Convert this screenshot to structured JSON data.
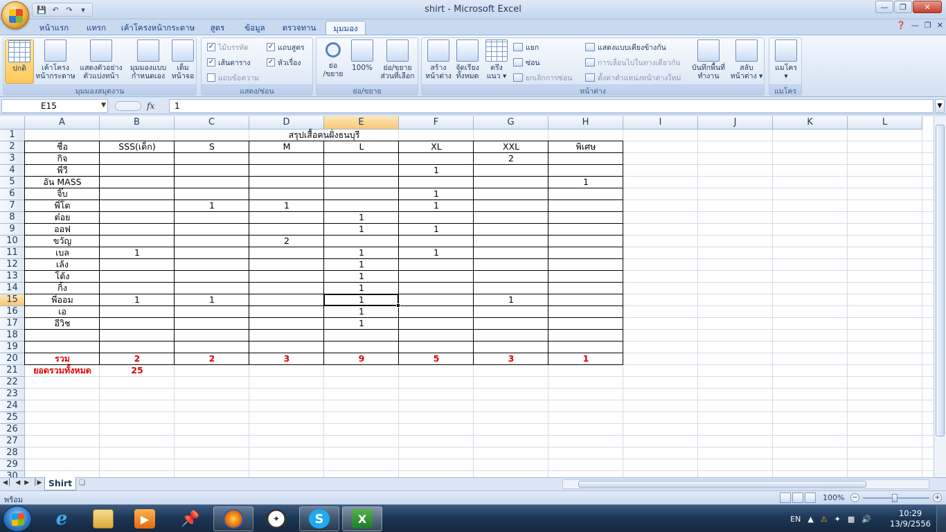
{
  "window": {
    "title": "shirt - Microsoft Excel"
  },
  "ribbon": {
    "tabs": [
      "หน้าแรก",
      "แทรก",
      "เค้าโครงหน้ากระดาษ",
      "สูตร",
      "ข้อมูล",
      "ตรวจทาน",
      "มุมมอง"
    ],
    "active_tab": "มุมมอง",
    "groups": {
      "workbook_views": {
        "label": "มุมมองสมุดงาน",
        "normal": "ปกติ",
        "page_layout_1": "เค้าโครง",
        "page_layout_2": "หน้ากระดาษ",
        "page_break_1": "แสดงตัวอย่าง",
        "page_break_2": "ตัวแบ่งหน้า",
        "custom_1": "มุมมองแบบ",
        "custom_2": "กำหนดเอง",
        "full_1": "เต็ม",
        "full_2": "หน้าจอ"
      },
      "show_hide": {
        "label": "แสดง/ซ่อน",
        "ruler": "ไม้บรรทัด",
        "gridlines": "เส้นตาราง",
        "message_bar": "แถบข้อความ",
        "formula_bar": "แถบสูตร",
        "headings": "หัวเรื่อง"
      },
      "zoom": {
        "label": "ย่อ/ขยาย",
        "zoom_1": "ย่อ",
        "zoom_2": "/ขยาย",
        "hundred": "100%",
        "selection_1": "ย่อ/ขยาย",
        "selection_2": "ส่วนที่เลือก"
      },
      "window": {
        "label": "หน้าต่าง",
        "new_1": "สร้าง",
        "new_2": "หน้าต่าง",
        "arrange_1": "จัดเรียง",
        "arrange_2": "ทั้งหมด",
        "freeze_1": "ตรึง",
        "freeze_2": "แนว",
        "split": "แยก",
        "hide": "ซ่อน",
        "unhide": "ยกเลิกการซ่อน",
        "side_by_side": "แสดงแบบเคียงข้างกัน",
        "sync_scroll": "การเลื่อนไปในทางเดียวกัน",
        "reset_pos": "ตั้งค่าตำแหน่งหน้าต่างใหม่",
        "save_ws_1": "บันทึกพื้นที่",
        "save_ws_2": "ทำงาน",
        "switch_1": "สลับ",
        "switch_2": "หน้าต่าง"
      },
      "macros": {
        "label": "แมโคร",
        "macros": "แมโคร"
      }
    }
  },
  "formula_bar": {
    "name_box": "E15",
    "fx": "fx",
    "value": "1"
  },
  "sheet": {
    "columns": [
      "A",
      "B",
      "C",
      "D",
      "E",
      "F",
      "G",
      "H",
      "I",
      "J",
      "K",
      "L"
    ],
    "selected_column": "E",
    "rows": [
      "1",
      "2",
      "3",
      "4",
      "5",
      "6",
      "7",
      "8",
      "9",
      "10",
      "11",
      "12",
      "13",
      "14",
      "15",
      "16",
      "17",
      "18",
      "19",
      "20",
      "21",
      "22",
      "23",
      "24",
      "25",
      "26",
      "27",
      "28",
      "29",
      "30"
    ],
    "selected_row": "15",
    "title": "สรุปเสื้อคนฝั่งธนบุรี",
    "header_row": [
      "ชื่อ",
      "SSS(เด็ก)",
      "S",
      "M",
      "L",
      "XL",
      "XXL",
      "พิเศษ"
    ],
    "data_rows": [
      [
        "กิจ",
        "",
        "",
        "",
        "",
        "",
        "2",
        ""
      ],
      [
        "พี่วี",
        "",
        "",
        "",
        "",
        "1",
        "",
        ""
      ],
      [
        "อัน MASS",
        "",
        "",
        "",
        "",
        "",
        "",
        "1"
      ],
      [
        "จิ๊บ",
        "",
        "",
        "",
        "",
        "1",
        "",
        ""
      ],
      [
        "พี่โต",
        "",
        "1",
        "1",
        "",
        "1",
        "",
        ""
      ],
      [
        "ต๋อย",
        "",
        "",
        "",
        "1",
        "",
        "",
        ""
      ],
      [
        "ออฟ",
        "",
        "",
        "",
        "1",
        "1",
        "",
        ""
      ],
      [
        "ขวัญ",
        "",
        "",
        "2",
        "",
        "",
        "",
        ""
      ],
      [
        "เบล",
        "1",
        "",
        "",
        "1",
        "1",
        "",
        ""
      ],
      [
        "เล้ง",
        "",
        "",
        "",
        "1",
        "",
        "",
        ""
      ],
      [
        "โต้ง",
        "",
        "",
        "",
        "1",
        "",
        "",
        ""
      ],
      [
        "กิ้ง",
        "",
        "",
        "",
        "1",
        "",
        "",
        ""
      ],
      [
        "พี่ออม",
        "1",
        "1",
        "",
        "1",
        "",
        "1",
        ""
      ],
      [
        "เอ",
        "",
        "",
        "",
        "1",
        "",
        "",
        ""
      ],
      [
        "อีวิช",
        "",
        "",
        "",
        "1",
        "",
        "",
        ""
      ],
      [
        "",
        "",
        "",
        "",
        "",
        "",
        "",
        ""
      ],
      [
        "",
        "",
        "",
        "",
        "",
        "",
        "",
        ""
      ]
    ],
    "total_row": [
      "รวม",
      "2",
      "2",
      "3",
      "9",
      "5",
      "3",
      "1"
    ],
    "grand_total_label": "ยอดรวมทั้งหมด",
    "grand_total_value": "25",
    "sheet_tabs": [
      "Shirt"
    ]
  },
  "status_bar": {
    "status": "พร้อม",
    "zoom": "100%"
  },
  "taskbar": {
    "language": "EN",
    "time": "10:29",
    "date": "13/9/2556"
  },
  "colors": {
    "accent": "#15428b",
    "total_red": "#e00000",
    "selection": "#f8c777"
  }
}
